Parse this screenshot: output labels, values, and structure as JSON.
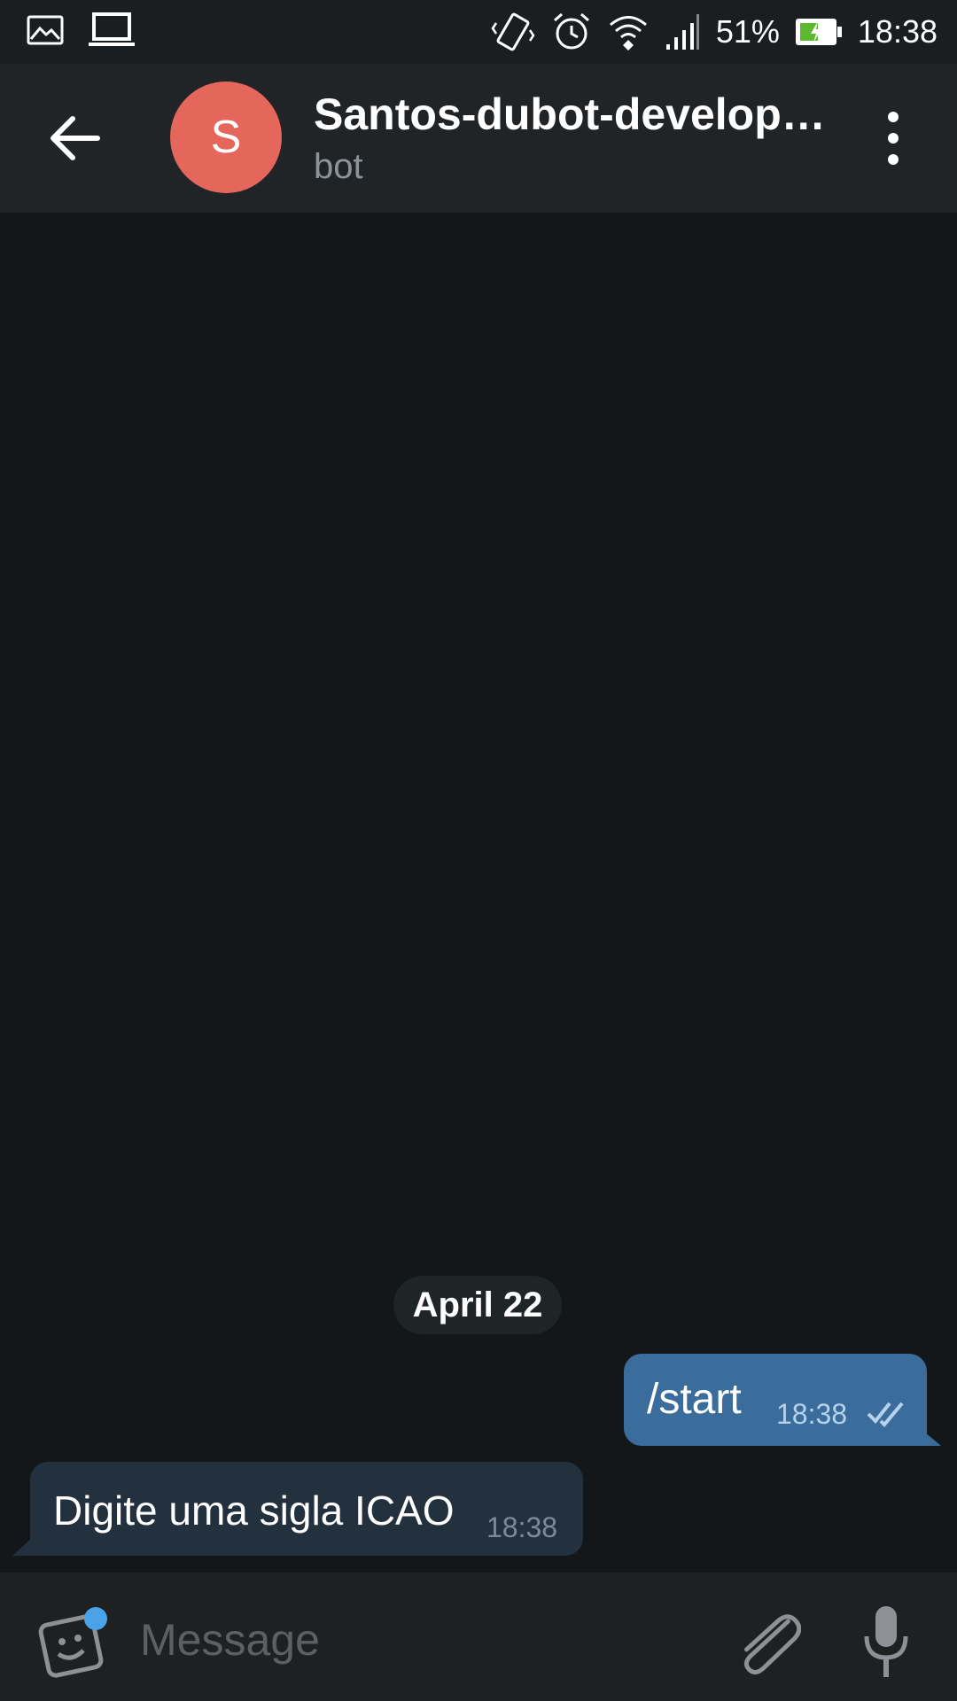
{
  "status_bar": {
    "battery_percent": "51%",
    "battery_level": 0.51,
    "time": "18:38",
    "icons": [
      "gallery-icon",
      "laptop-icon",
      "vibrate-icon",
      "alarm-icon",
      "wifi-icon",
      "signal-icon",
      "battery-charging-icon"
    ]
  },
  "header": {
    "avatar_letter": "S",
    "title": "Santos-dubot-develop…",
    "subtitle": "bot",
    "avatar_color": "#e5665a"
  },
  "messages": {
    "date": "April 22",
    "outgoing": {
      "text": "/start",
      "time": "18:38"
    },
    "incoming": {
      "text": "Digite uma sigla ICAO",
      "time": "18:38"
    }
  },
  "input_bar": {
    "placeholder": "Message"
  },
  "colors": {
    "outgoing_bubble": "#3a6d9c",
    "incoming_bubble": "#23303d",
    "accent_dot": "#4aa3e8"
  }
}
